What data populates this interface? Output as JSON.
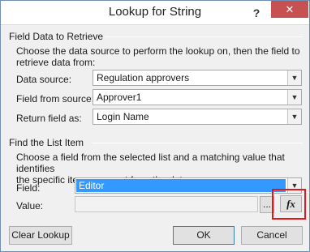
{
  "titlebar": {
    "title": "Lookup for String",
    "help": "?",
    "close": "✕"
  },
  "field_data": {
    "heading": "Field Data to Retrieve",
    "description_line1": "Choose the data source to perform the lookup on, then the field to",
    "description_line2": "retrieve data from:",
    "data_source": {
      "label": "Data source:",
      "value": "Regulation approvers"
    },
    "field_from_source": {
      "label": "Field from source:",
      "value": "Approver1"
    },
    "return_field": {
      "label": "Return field as:",
      "value": "Login Name"
    }
  },
  "find_item": {
    "heading": "Find the List Item",
    "description_line1": "Choose a field from the selected list and a matching value that identifies",
    "description_line2": "the specific item you want from the data source:",
    "field": {
      "label": "Field:",
      "value": "Editor"
    },
    "value": {
      "label": "Value:",
      "value": "",
      "browse": "...",
      "fx": "fx"
    }
  },
  "buttons": {
    "clear_lookup": "Clear Lookup",
    "ok": "OK",
    "cancel": "Cancel"
  },
  "icons": {
    "dropdown": "chevron-down-icon",
    "formula": "fx-icon"
  },
  "colors": {
    "selection": "#3399ff",
    "highlight_box": "#e3161b",
    "close_button": "#c75050"
  }
}
